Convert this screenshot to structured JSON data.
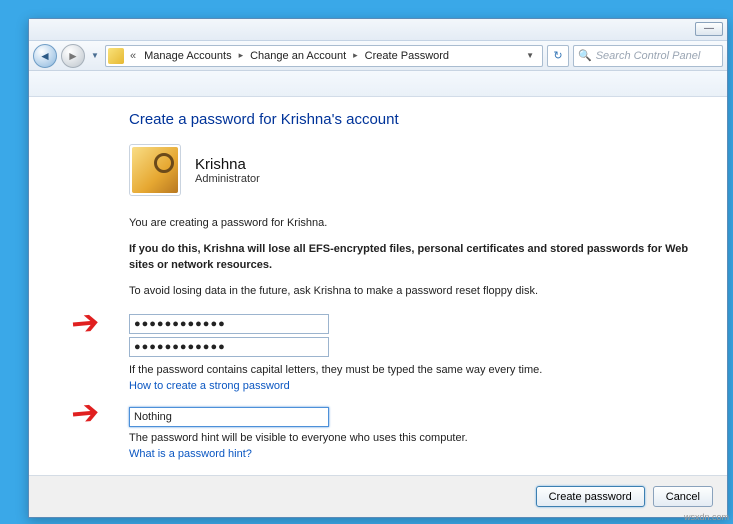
{
  "window": {
    "minimize_glyph": "—"
  },
  "nav": {
    "back_glyph": "◄",
    "fwd_glyph": "►",
    "dd_glyph": "▼",
    "refresh_glyph": "↻"
  },
  "breadcrumb": {
    "lead": "«",
    "items": [
      "Manage Accounts",
      "Change an Account",
      "Create Password"
    ]
  },
  "search": {
    "placeholder": "Search Control Panel"
  },
  "page": {
    "heading": "Create a password for Krishna's account",
    "user": {
      "name": "Krishna",
      "role": "Administrator"
    },
    "line1": "You are creating a password for Krishna.",
    "warn": "If you do this, Krishna will lose all EFS-encrypted files, personal certificates and stored passwords for Web sites or network resources.",
    "line2": "To avoid losing data in the future, ask Krishna to make a password reset floppy disk.",
    "pw_value": "●●●●●●●●●●●●",
    "pw_confirm": "●●●●●●●●●●●●",
    "caps_note": "If the password contains capital letters, they must be typed the same way every time.",
    "link1": "How to create a strong password",
    "hint_value": "Nothing",
    "hint_note": "The password hint will be visible to everyone who uses this computer.",
    "link2": "What is a password hint?"
  },
  "buttons": {
    "create": "Create password",
    "cancel": "Cancel"
  },
  "watermark": "wsxdn.com"
}
